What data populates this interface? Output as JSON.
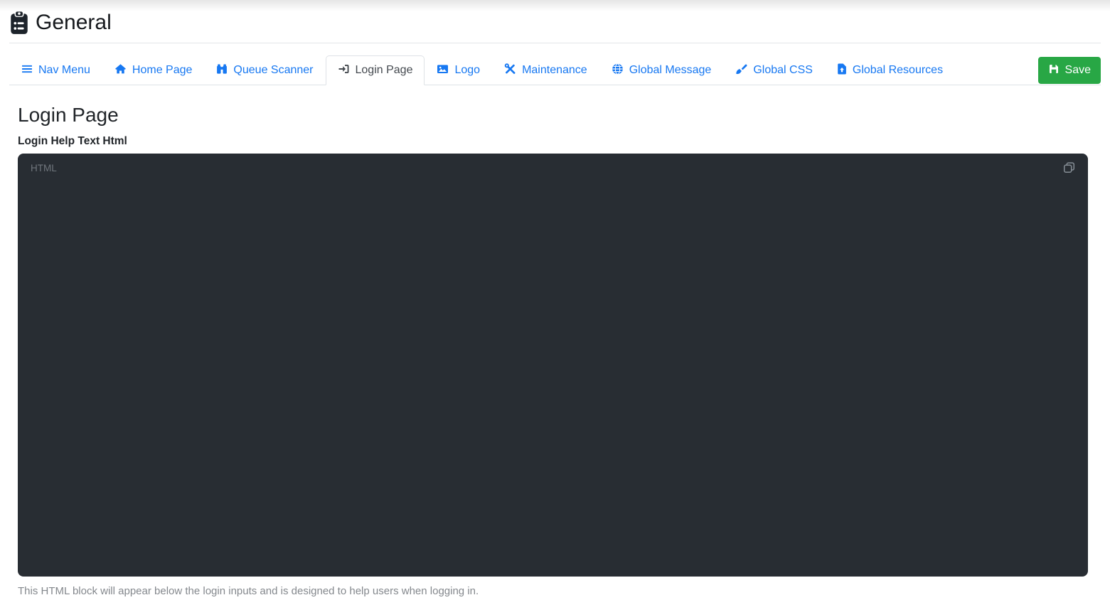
{
  "page": {
    "title": "General",
    "title_icon": "clipboard-list"
  },
  "tabs": [
    {
      "label": "Nav Menu",
      "icon": "bars",
      "active": false
    },
    {
      "label": "Home Page",
      "icon": "home",
      "active": false
    },
    {
      "label": "Queue Scanner",
      "icon": "binoculars",
      "active": false
    },
    {
      "label": "Login Page",
      "icon": "sign-in",
      "active": true
    },
    {
      "label": "Logo",
      "icon": "image",
      "active": false
    },
    {
      "label": "Maintenance",
      "icon": "screwdriver-wrench",
      "active": false
    },
    {
      "label": "Global Message",
      "icon": "globe",
      "active": false
    },
    {
      "label": "Global CSS",
      "icon": "paintbrush",
      "active": false
    },
    {
      "label": "Global Resources",
      "icon": "file-arrow-up",
      "active": false
    }
  ],
  "toolbar": {
    "save_label": "Save",
    "save_icon": "floppy-disk"
  },
  "content": {
    "heading": "Login Page",
    "field_label": "Login Help Text Html",
    "editor": {
      "language_badge": "HTML",
      "value": "",
      "copy_icon": "copy"
    },
    "help_text": "This HTML block will appear below the login inputs and is designed to help users when logging in."
  },
  "colors": {
    "accent_blue": "#1778f2",
    "save_green": "#28a745",
    "editor_background": "#282d33",
    "tab_border": "#dee2e6",
    "active_tab_text": "#44494f",
    "muted_text": "#84888d"
  }
}
